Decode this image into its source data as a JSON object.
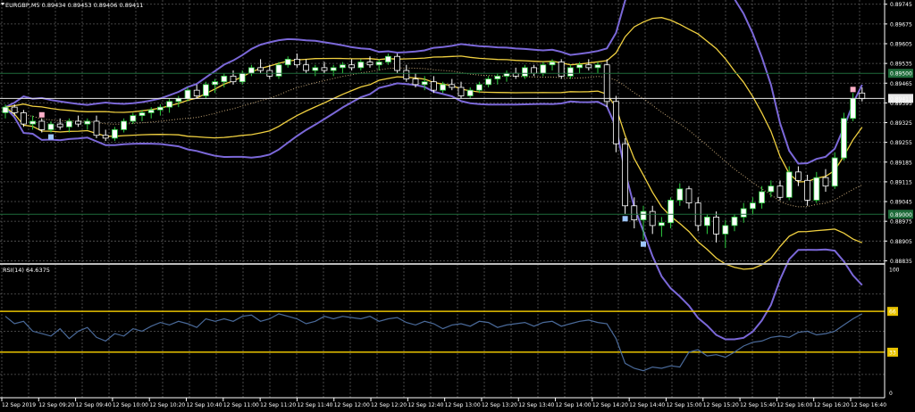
{
  "main": {
    "header": "EURGBP,M5  0.89434 0.89453 0.89406 0.89411",
    "y_min": 0.8883,
    "y_max": 0.8976,
    "price_ticks": [
      "0.89745",
      "0.89675",
      "0.89605",
      "0.89535",
      "0.89465",
      "0.89395",
      "0.89325",
      "0.89255",
      "0.89185",
      "0.89115",
      "0.89045",
      "0.88975",
      "0.88905",
      "0.88835"
    ],
    "markers": [
      {
        "price": 0.895,
        "label": "0.89500",
        "color": "#1e6b3a"
      },
      {
        "price": 0.89411,
        "label": "0.89411",
        "color": "#e8e8e8"
      },
      {
        "price": 0.89,
        "label": "0.89000",
        "color": "#1e6b3a"
      }
    ]
  },
  "rsi": {
    "header": "RSI(14) 64.6375",
    "scale_labels": [
      "100",
      "66",
      "33",
      "0"
    ],
    "levels": [
      66,
      33
    ],
    "level_color": "#e8c300"
  },
  "time_labels": [
    "12 Sep 2019",
    "12 Sep 09:20",
    "12 Sep 09:40",
    "12 Sep 10:00",
    "12 Sep 10:20",
    "12 Sep 10:40",
    "12 Sep 11:00",
    "12 Sep 11:20",
    "12 Sep 11:40",
    "12 Sep 12:00",
    "12 Sep 12:20",
    "12 Sep 12:40",
    "12 Sep 13:00",
    "12 Sep 13:20",
    "12 Sep 13:40",
    "12 Sep 14:00",
    "12 Sep 14:20",
    "12 Sep 14:40",
    "12 Sep 15:00",
    "12 Sep 15:20",
    "12 Sep 15:40",
    "12 Sep 16:00",
    "12 Sep 16:20",
    "12 Sep 16:40"
  ],
  "colors": {
    "background": "#000000",
    "grid": "#5a5a5a",
    "bull_body": "#ffffff",
    "bear_body": "#000000",
    "bull_wick": "#2ecc40",
    "bear_wick": "#ffffff",
    "bollinger_outer": "#7b68d8",
    "bollinger_inner": "#f0d040",
    "rsi_line": "#4a6a9a",
    "dotted_ma": "#c8a878",
    "marker_blue": "#9ec6ff",
    "marker_pink": "#ffb0c8"
  },
  "chart_data": [
    {
      "type": "candlestick",
      "title": "EURGBP,M5",
      "last_bar": {
        "open": 0.89434,
        "high": 0.89453,
        "low": 0.89406,
        "close": 0.89411
      },
      "x": [
        "09:00",
        "09:05",
        "09:10",
        "09:15",
        "09:20",
        "09:25",
        "09:30",
        "09:35",
        "09:40",
        "09:45",
        "09:50",
        "09:55",
        "10:00",
        "10:05",
        "10:10",
        "10:15",
        "10:20",
        "10:25",
        "10:30",
        "10:35",
        "10:40",
        "10:45",
        "10:50",
        "10:55",
        "11:00",
        "11:05",
        "11:10",
        "11:15",
        "11:20",
        "11:25",
        "11:30",
        "11:35",
        "11:40",
        "11:45",
        "11:50",
        "11:55",
        "12:00",
        "12:05",
        "12:10",
        "12:15",
        "12:20",
        "12:25",
        "12:30",
        "12:35",
        "12:40",
        "12:45",
        "12:50",
        "12:55",
        "13:00",
        "13:05",
        "13:10",
        "13:15",
        "13:20",
        "13:25",
        "13:30",
        "13:35",
        "13:40",
        "13:45",
        "13:50",
        "13:55",
        "14:00",
        "14:05",
        "14:10",
        "14:15",
        "14:20",
        "14:25",
        "14:30",
        "14:35",
        "14:40",
        "14:45",
        "14:50",
        "14:55",
        "15:00",
        "15:05",
        "15:10",
        "15:15",
        "15:20",
        "15:25",
        "15:30",
        "15:35",
        "15:40",
        "15:45",
        "15:50",
        "15:55",
        "16:00",
        "16:05",
        "16:10",
        "16:15",
        "16:20",
        "16:25",
        "16:30",
        "16:35",
        "16:40",
        "16:45"
      ],
      "ohlc": [
        [
          0.8936,
          0.8939,
          0.8934,
          0.8938
        ],
        [
          0.8938,
          0.8939,
          0.8935,
          0.8936
        ],
        [
          0.8936,
          0.8937,
          0.8931,
          0.8932
        ],
        [
          0.8932,
          0.8935,
          0.893,
          0.8933
        ],
        [
          0.8933,
          0.8934,
          0.8929,
          0.893
        ],
        [
          0.893,
          0.8933,
          0.8929,
          0.8932
        ],
        [
          0.8932,
          0.8934,
          0.893,
          0.8931
        ],
        [
          0.8931,
          0.8934,
          0.8929,
          0.8933
        ],
        [
          0.8933,
          0.8935,
          0.8931,
          0.8932
        ],
        [
          0.8932,
          0.8934,
          0.893,
          0.8933
        ],
        [
          0.8933,
          0.8935,
          0.8927,
          0.8928
        ],
        [
          0.8928,
          0.893,
          0.8926,
          0.8927
        ],
        [
          0.8927,
          0.8931,
          0.8926,
          0.893
        ],
        [
          0.893,
          0.8934,
          0.8929,
          0.8933
        ],
        [
          0.8933,
          0.8936,
          0.8932,
          0.8935
        ],
        [
          0.8935,
          0.8937,
          0.8933,
          0.8936
        ],
        [
          0.8936,
          0.8938,
          0.8934,
          0.8937
        ],
        [
          0.8937,
          0.8939,
          0.8935,
          0.8938
        ],
        [
          0.8938,
          0.8941,
          0.8936,
          0.894
        ],
        [
          0.894,
          0.8942,
          0.8938,
          0.8941
        ],
        [
          0.8941,
          0.8945,
          0.894,
          0.8944
        ],
        [
          0.8944,
          0.8946,
          0.8941,
          0.8942
        ],
        [
          0.8942,
          0.8947,
          0.8941,
          0.8946
        ],
        [
          0.8946,
          0.8948,
          0.8943,
          0.8947
        ],
        [
          0.8947,
          0.895,
          0.8945,
          0.8949
        ],
        [
          0.8949,
          0.8951,
          0.8946,
          0.8947
        ],
        [
          0.8947,
          0.8951,
          0.8946,
          0.895
        ],
        [
          0.895,
          0.8953,
          0.8949,
          0.8952
        ],
        [
          0.8952,
          0.8955,
          0.895,
          0.8951
        ],
        [
          0.8951,
          0.8953,
          0.8948,
          0.8949
        ],
        [
          0.8949,
          0.8954,
          0.8948,
          0.8953
        ],
        [
          0.8953,
          0.8956,
          0.8952,
          0.8955
        ],
        [
          0.8955,
          0.8957,
          0.8952,
          0.8953
        ],
        [
          0.8953,
          0.8955,
          0.895,
          0.8951
        ],
        [
          0.8951,
          0.8953,
          0.8949,
          0.8952
        ],
        [
          0.8952,
          0.8954,
          0.895,
          0.8951
        ],
        [
          0.8951,
          0.8953,
          0.8949,
          0.8952
        ],
        [
          0.8952,
          0.8954,
          0.895,
          0.8953
        ],
        [
          0.8953,
          0.8955,
          0.8951,
          0.8952
        ],
        [
          0.8952,
          0.8955,
          0.8951,
          0.8954
        ],
        [
          0.8954,
          0.8956,
          0.8952,
          0.8953
        ],
        [
          0.8953,
          0.8955,
          0.8951,
          0.8954
        ],
        [
          0.8954,
          0.8957,
          0.8953,
          0.8956
        ],
        [
          0.8956,
          0.8957,
          0.895,
          0.8951
        ],
        [
          0.8951,
          0.8953,
          0.8947,
          0.8948
        ],
        [
          0.8948,
          0.895,
          0.8945,
          0.8946
        ],
        [
          0.8946,
          0.8949,
          0.8944,
          0.8947
        ],
        [
          0.8947,
          0.8949,
          0.8943,
          0.8944
        ],
        [
          0.8944,
          0.8947,
          0.8943,
          0.8946
        ],
        [
          0.8946,
          0.8948,
          0.8944,
          0.8945
        ],
        [
          0.8945,
          0.8947,
          0.8941,
          0.8942
        ],
        [
          0.8942,
          0.8945,
          0.8941,
          0.8944
        ],
        [
          0.8944,
          0.8947,
          0.8943,
          0.8946
        ],
        [
          0.8946,
          0.8949,
          0.8945,
          0.8948
        ],
        [
          0.8948,
          0.895,
          0.8946,
          0.8949
        ],
        [
          0.8949,
          0.8951,
          0.8947,
          0.895
        ],
        [
          0.895,
          0.8952,
          0.8948,
          0.8949
        ],
        [
          0.8949,
          0.8953,
          0.8948,
          0.8952
        ],
        [
          0.8952,
          0.8953,
          0.8949,
          0.895
        ],
        [
          0.895,
          0.8954,
          0.8949,
          0.8953
        ],
        [
          0.8953,
          0.8955,
          0.8951,
          0.8954
        ],
        [
          0.8954,
          0.8955,
          0.8948,
          0.8949
        ],
        [
          0.8949,
          0.8953,
          0.8948,
          0.8952
        ],
        [
          0.8952,
          0.8954,
          0.895,
          0.8953
        ],
        [
          0.8953,
          0.8955,
          0.8951,
          0.8952
        ],
        [
          0.8952,
          0.8954,
          0.895,
          0.8953
        ],
        [
          0.8953,
          0.8955,
          0.8938,
          0.894
        ],
        [
          0.894,
          0.8942,
          0.8922,
          0.8925
        ],
        [
          0.8925,
          0.8927,
          0.89,
          0.8903
        ],
        [
          0.8903,
          0.8906,
          0.8895,
          0.8898
        ],
        [
          0.8898,
          0.8903,
          0.8891,
          0.8901
        ],
        [
          0.8901,
          0.8903,
          0.8893,
          0.8896
        ],
        [
          0.8896,
          0.8899,
          0.8892,
          0.8897
        ],
        [
          0.8897,
          0.8906,
          0.8895,
          0.8905
        ],
        [
          0.8905,
          0.8911,
          0.8903,
          0.8909
        ],
        [
          0.8909,
          0.891,
          0.8902,
          0.8904
        ],
        [
          0.8904,
          0.8906,
          0.8894,
          0.8896
        ],
        [
          0.8896,
          0.89,
          0.8893,
          0.8899
        ],
        [
          0.8899,
          0.8901,
          0.889,
          0.8893
        ],
        [
          0.8893,
          0.8898,
          0.8888,
          0.8896
        ],
        [
          0.8896,
          0.89,
          0.8894,
          0.8899
        ],
        [
          0.8899,
          0.8904,
          0.8897,
          0.8902
        ],
        [
          0.8902,
          0.8906,
          0.89,
          0.8904
        ],
        [
          0.8904,
          0.891,
          0.8902,
          0.8908
        ],
        [
          0.8908,
          0.8912,
          0.8906,
          0.891
        ],
        [
          0.891,
          0.8912,
          0.8905,
          0.8906
        ],
        [
          0.8906,
          0.8917,
          0.8905,
          0.8915
        ],
        [
          0.8915,
          0.8917,
          0.891,
          0.8912
        ],
        [
          0.8912,
          0.8914,
          0.8903,
          0.8905
        ],
        [
          0.8905,
          0.8915,
          0.8904,
          0.8913
        ],
        [
          0.8913,
          0.8916,
          0.8908,
          0.891
        ],
        [
          0.891,
          0.8922,
          0.8909,
          0.892
        ],
        [
          0.892,
          0.8936,
          0.8919,
          0.8934
        ],
        [
          0.8934,
          0.8943,
          0.8933,
          0.8941
        ],
        [
          0.8943,
          0.8945,
          0.894,
          0.8941
        ]
      ]
    },
    {
      "type": "line",
      "title": "RSI(14) 64.6375",
      "ylim": [
        0,
        100
      ],
      "values": [
        62,
        56,
        58,
        50,
        48,
        46,
        52,
        44,
        50,
        53,
        45,
        42,
        48,
        46,
        52,
        50,
        54,
        57,
        55,
        58,
        56,
        53,
        60,
        58,
        60,
        58,
        62,
        63,
        58,
        60,
        64,
        62,
        60,
        56,
        58,
        62,
        60,
        62,
        61,
        60,
        62,
        58,
        60,
        61,
        57,
        55,
        58,
        56,
        52,
        55,
        56,
        54,
        58,
        57,
        53,
        55,
        56,
        57,
        54,
        57,
        58,
        54,
        56,
        58,
        59,
        57,
        56,
        44,
        24,
        20,
        18,
        21,
        20,
        22,
        21,
        33,
        35,
        30,
        31,
        29,
        33,
        38,
        41,
        42,
        45,
        46,
        45,
        49,
        50,
        47,
        48,
        50,
        55,
        60,
        64
      ]
    }
  ]
}
